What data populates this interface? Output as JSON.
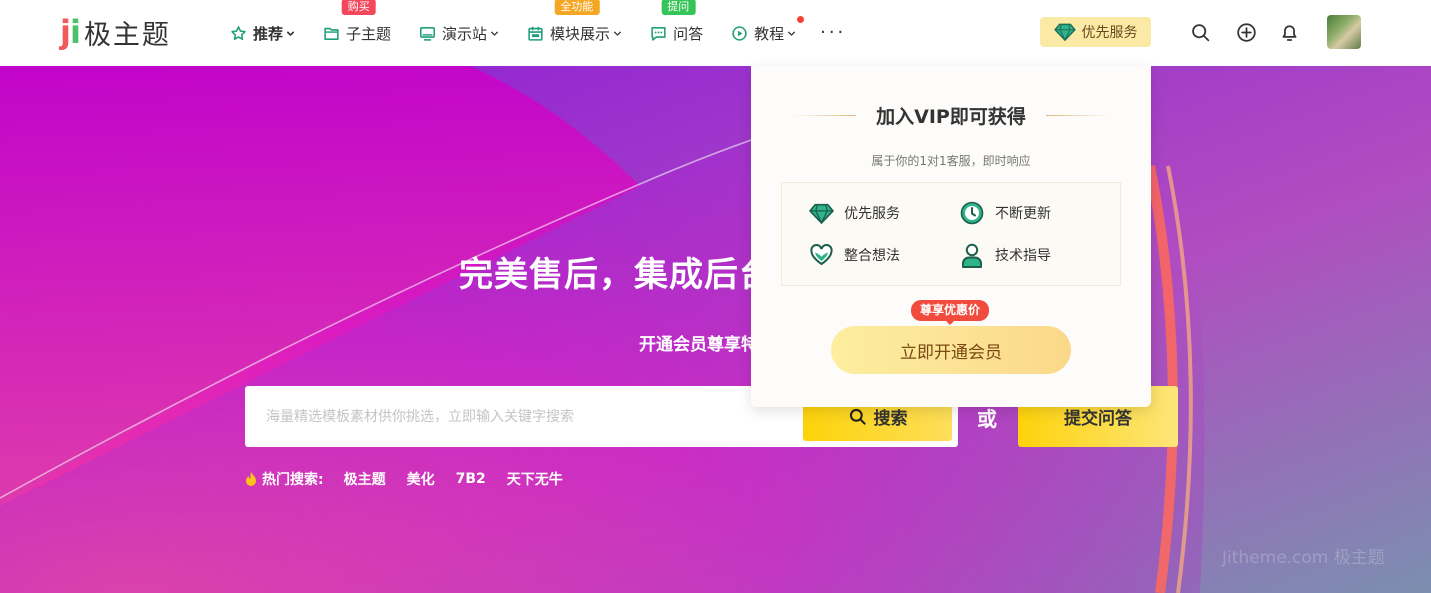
{
  "logo": {
    "mark_j": "j",
    "mark_i": "i",
    "text": "极主题"
  },
  "nav": {
    "items": [
      {
        "label": "推荐",
        "badge": "",
        "icon": "star-icon"
      },
      {
        "label": "子主题",
        "badge": "购买",
        "icon": "folder-icon"
      },
      {
        "label": "演示站",
        "badge": "",
        "icon": "monitor-icon"
      },
      {
        "label": "模块展示",
        "badge": "全功能",
        "icon": "calendar-icon"
      },
      {
        "label": "问答",
        "badge": "提问",
        "icon": "chat-icon"
      },
      {
        "label": "教程",
        "badge": "",
        "icon": "play-icon"
      }
    ],
    "more": "···"
  },
  "header": {
    "vip_label": "优先服务"
  },
  "hero": {
    "title": "完美售后，集成后台",
    "subtitle": "开通会员尊享特权",
    "search_placeholder": "海量精选模板素材供你挑选，立即输入关键字搜索",
    "search_label": "搜索",
    "or_label": "或",
    "ask_label": "提交问答",
    "hot_label": "热门搜索:",
    "hot_links": [
      "极主题",
      "美化",
      "7B2",
      "天下无牛"
    ],
    "watermark": "Jitheme.com 极主题"
  },
  "vip_popup": {
    "title": "加入VIP即可获得",
    "subtitle": "属于你的1对1客服，即时响应",
    "features": [
      {
        "label": "优先服务",
        "icon": "diamond-icon"
      },
      {
        "label": "不断更新",
        "icon": "clock-icon"
      },
      {
        "label": "整合想法",
        "icon": "heart-icon"
      },
      {
        "label": "技术指导",
        "icon": "user-icon"
      }
    ],
    "tag": "尊享优惠价",
    "cta": "立即开通会员"
  },
  "colors": {
    "accent_yellow": "#fdd30a",
    "badge_red": "#f4475c",
    "badge_orange": "#f5a623",
    "badge_green": "#35c457",
    "popup_tag": "#f04b3c",
    "icon_green": "#1f9e7a"
  }
}
